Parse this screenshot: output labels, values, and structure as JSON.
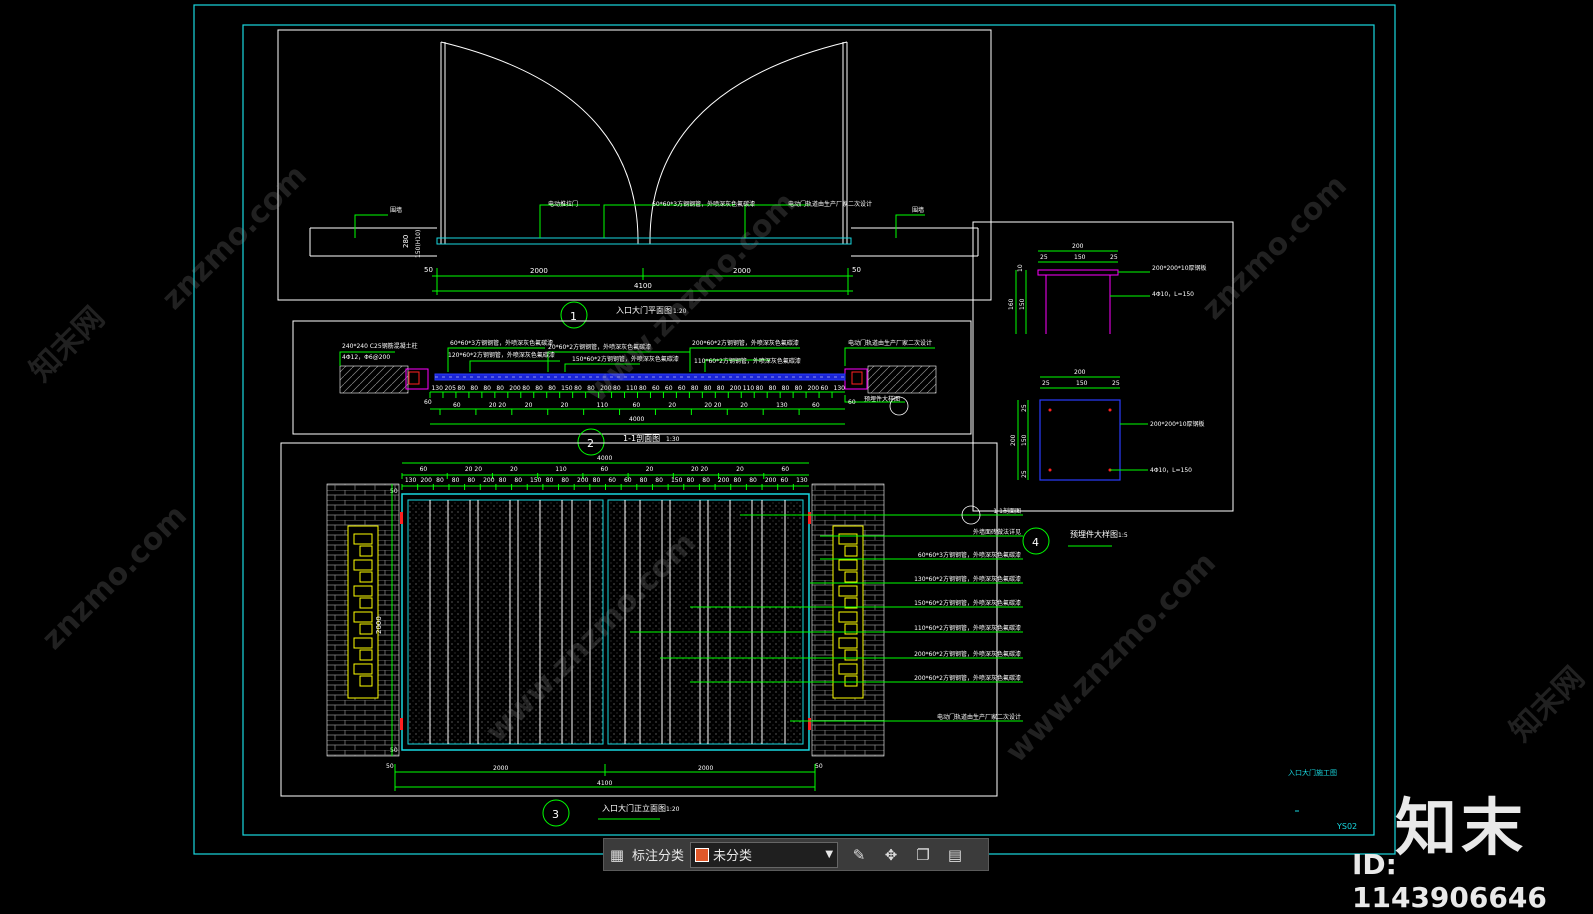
{
  "drawing": {
    "view1": {
      "number": "1",
      "title": "入口大门平面图",
      "scale": "1:20",
      "dims": [
        "50",
        "2000",
        "2000",
        "50",
        "4100",
        "280",
        "150(H10)"
      ],
      "labels": [
        "围墙",
        "电动推拉门",
        "60*60*3方钢钢管，外喷深灰色氟碳漆",
        "电动门轨道由生产厂家二次设计",
        "围墙"
      ]
    },
    "view2": {
      "number": "2",
      "title": "1-1剖面图",
      "scale": "1:30",
      "labels": [
        "240*240 C25钢筋混凝土柱",
        "4Φ12，Φ6@200",
        "60*60*3方钢钢管，外喷深灰色氟碳漆",
        "120*60*2方钢钢管，外喷深灰色氟碳漆",
        "20*60*2方钢钢管，外喷深灰色氟碳漆",
        "150*60*2方钢钢管，外喷深灰色氟碳漆",
        "200*60*2方钢钢管，外喷深灰色氟碳漆",
        "110*60*2方钢钢管，外喷深灰色氟碳漆",
        "电动门轨道由生产厂家二次设计",
        "预埋件大样图"
      ],
      "dims_top": [
        "130",
        "205",
        "80",
        "80",
        "80",
        "80",
        "200",
        "80",
        "80",
        "80",
        "150",
        "80",
        "80",
        "200",
        "80",
        "110",
        "80",
        "60",
        "60",
        "60",
        "80",
        "80",
        "80",
        "200",
        "110",
        "80",
        "80",
        "80",
        "80",
        "200",
        "60",
        "130"
      ],
      "dims_bottom": [
        "60",
        "20 20",
        "20",
        "20",
        "110",
        "60",
        "20",
        "20 20",
        "20",
        "130",
        "60"
      ],
      "total": "4000",
      "side": "60"
    },
    "view3": {
      "number": "3",
      "title": "入口大门正立面图",
      "scale": "1:20",
      "total_top": "4000",
      "dims_top": [
        "60",
        "20 20",
        "20",
        "110",
        "60",
        "20",
        "20 20",
        "20",
        "60"
      ],
      "dims_top2": [
        "130",
        "200",
        "80",
        "80",
        "80",
        "200",
        "80",
        "80",
        "150",
        "80",
        "80",
        "200",
        "80",
        "60",
        "60",
        "80",
        "80",
        "150",
        "80",
        "80",
        "200",
        "80",
        "80",
        "200",
        "60",
        "130"
      ],
      "dims_bottom": [
        "2000",
        "2000"
      ],
      "total_bottom": "4100",
      "side_dims": [
        "50",
        "50",
        "50",
        "50"
      ],
      "height": "2000",
      "callouts": [
        "1-1剖面图",
        "外墙面砖做法详见",
        "60*60*3方钢钢管，外喷深灰色氟碳漆",
        "130*60*2方钢钢管，外喷深灰色氟碳漆",
        "150*60*2方钢钢管，外喷深灰色氟碳漆",
        "110*60*2方钢钢管，外喷深灰色氟碳漆",
        "200*60*2方钢钢管，外喷深灰色氟碳漆",
        "200*60*2方钢钢管，外喷深灰色氟碳漆",
        "电动门轨道由生产厂家二次设计"
      ]
    },
    "view4": {
      "number": "4",
      "title": "预埋件大样图",
      "scale": "1:5",
      "dims_top": [
        "200",
        "25",
        "150",
        "25"
      ],
      "side_dims": [
        "10",
        "150",
        "160"
      ],
      "labels": [
        "200*200*10厚钢板",
        "4Φ10，L=150"
      ],
      "plan_dims_top": [
        "200",
        "25",
        "150",
        "25"
      ],
      "plan_side": [
        "25",
        "150",
        "25",
        "200"
      ],
      "plan_labels": [
        "200*200*10厚钢板",
        "4Φ10，L=150"
      ]
    },
    "sheet_title": "入口大门施工图",
    "sheet_no": "YS02",
    "watermark": "znzmo.com",
    "watermark2": "www.znzmo.com",
    "watermark3": "知末网"
  },
  "toolbar": {
    "label": "标注分类",
    "category": "未分类",
    "swatch_color": "#e0582a",
    "icons": [
      "layout-grid-icon",
      "chevron-down-icon",
      "edit-icon",
      "move-icon",
      "copy-icon",
      "paste-icon"
    ]
  },
  "brand": {
    "logo": "知末",
    "id": "ID: 1143906646"
  },
  "colors": {
    "frame": "#19d8e0",
    "white": "#ffffff",
    "green": "#00ff00",
    "blue": "#2a3cff",
    "magenta": "#ff00ff",
    "yellow": "#ffff00",
    "red": "#ff2020",
    "grey": "#9a9a9a"
  }
}
